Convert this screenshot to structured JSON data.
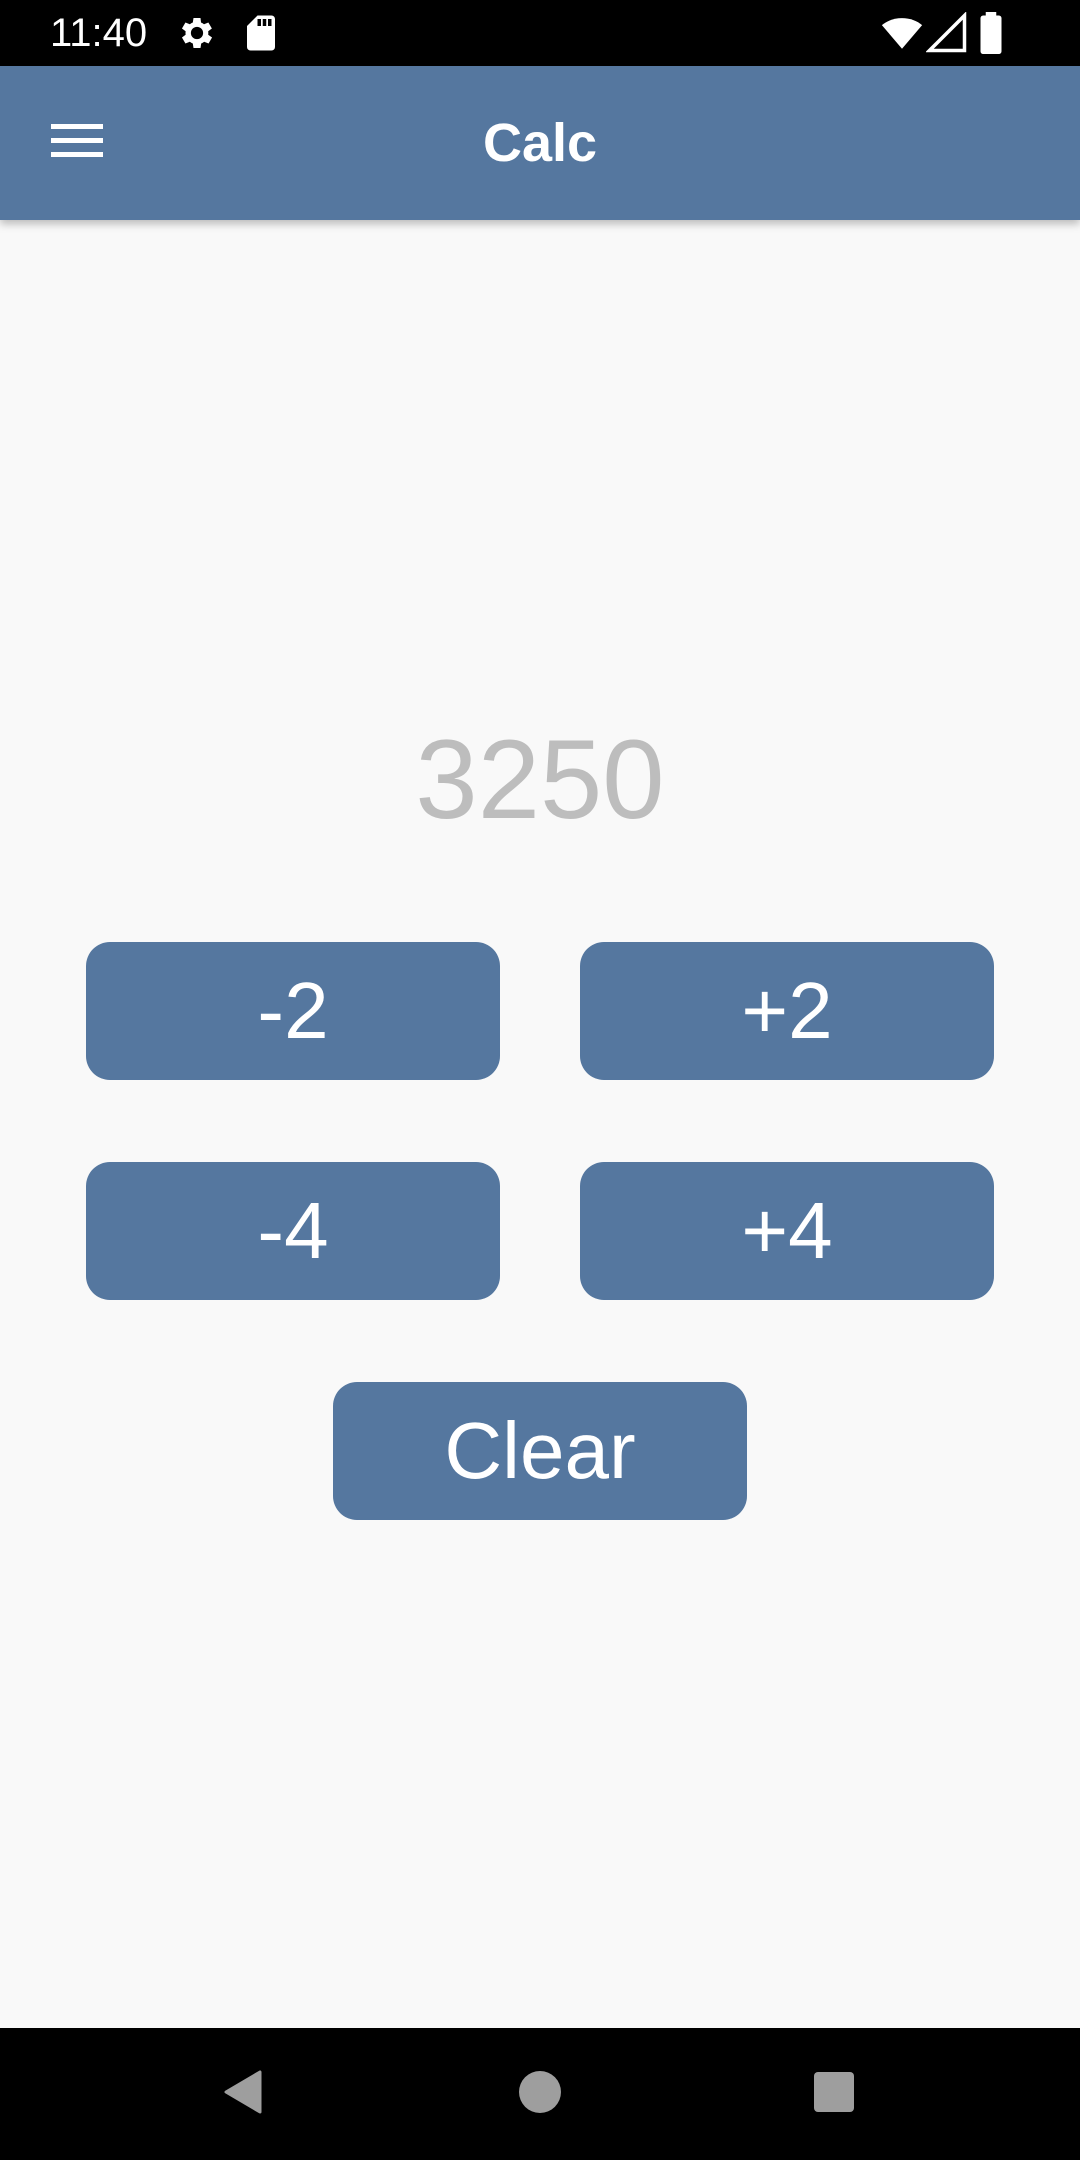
{
  "status_bar": {
    "time": "11:40",
    "icons_left": [
      "settings-icon",
      "sd-card-icon"
    ],
    "icons_right": [
      "wifi-icon",
      "signal-icon",
      "battery-icon"
    ]
  },
  "app_bar": {
    "title": "Calc",
    "menu_icon": "hamburger-menu-icon",
    "color": "#55779f"
  },
  "display": {
    "value": "3250",
    "color": "#bdbdbd"
  },
  "buttons": {
    "minus_2": "-2",
    "plus_2": "+2",
    "minus_4": "-4",
    "plus_4": "+4",
    "clear": "Clear"
  },
  "nav_bar": {
    "back_icon": "back-triangle-icon",
    "home_icon": "home-circle-icon",
    "recents_icon": "recents-square-icon"
  }
}
